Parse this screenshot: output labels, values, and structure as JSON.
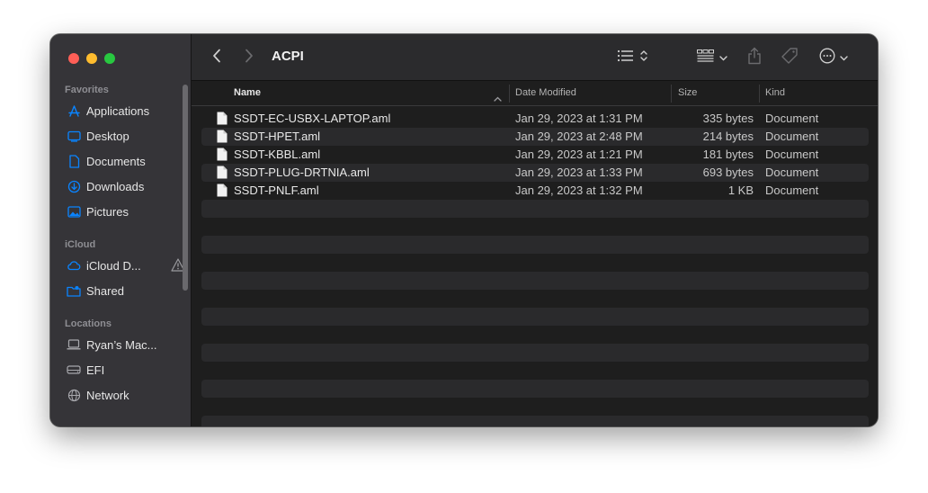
{
  "window": {
    "title": "ACPI"
  },
  "sidebar": {
    "favorites_label": "Favorites",
    "favorites": [
      {
        "label": "Applications",
        "icon": "applications-icon"
      },
      {
        "label": "Desktop",
        "icon": "desktop-icon"
      },
      {
        "label": "Documents",
        "icon": "documents-icon"
      },
      {
        "label": "Downloads",
        "icon": "downloads-icon"
      },
      {
        "label": "Pictures",
        "icon": "pictures-icon"
      }
    ],
    "icloud_label": "iCloud",
    "icloud": [
      {
        "label": "iCloud D...",
        "icon": "cloud-icon"
      },
      {
        "label": "Shared",
        "icon": "shared-folder-icon"
      }
    ],
    "locations_label": "Locations",
    "locations": [
      {
        "label": "Ryan’s Mac...",
        "icon": "laptop-icon"
      },
      {
        "label": "EFI",
        "icon": "drive-icon"
      },
      {
        "label": "Network",
        "icon": "network-icon"
      }
    ]
  },
  "columns": {
    "name": "Name",
    "date": "Date Modified",
    "size": "Size",
    "kind": "Kind"
  },
  "files": [
    {
      "name": "SSDT-EC-USBX-LAPTOP.aml",
      "date": "Jan 29, 2023 at 1:31 PM",
      "size": "335 bytes",
      "kind": "Document"
    },
    {
      "name": "SSDT-HPET.aml",
      "date": "Jan 29, 2023 at 2:48 PM",
      "size": "214 bytes",
      "kind": "Document"
    },
    {
      "name": "SSDT-KBBL.aml",
      "date": "Jan 29, 2023 at 1:21 PM",
      "size": "181 bytes",
      "kind": "Document"
    },
    {
      "name": "SSDT-PLUG-DRTNIA.aml",
      "date": "Jan 29, 2023 at 1:33 PM",
      "size": "693 bytes",
      "kind": "Document"
    },
    {
      "name": "SSDT-PNLF.aml",
      "date": "Jan 29, 2023 at 1:32 PM",
      "size": "1 KB",
      "kind": "Document"
    }
  ],
  "colors": {
    "accent": "#0a84ff",
    "close": "#ff5f57",
    "minimize": "#febc2e",
    "maximize": "#28c840"
  }
}
